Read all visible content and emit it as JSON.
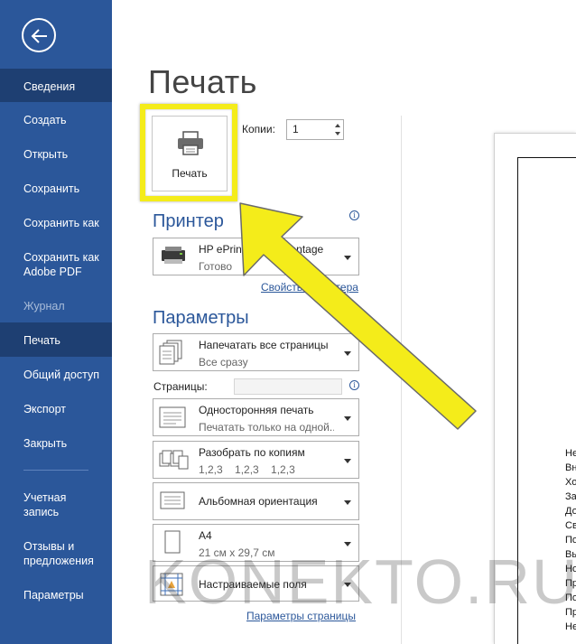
{
  "sidebar": {
    "items": [
      {
        "label": "Сведения",
        "state": "active"
      },
      {
        "label": "Создать",
        "state": "normal"
      },
      {
        "label": "Открыть",
        "state": "normal"
      },
      {
        "label": "Сохранить",
        "state": "normal"
      },
      {
        "label": "Сохранить как",
        "state": "normal"
      },
      {
        "label": "Сохранить как\nAdobe PDF",
        "state": "normal"
      },
      {
        "label": "Журнал",
        "state": "disabled"
      },
      {
        "label": "Печать",
        "state": "current"
      },
      {
        "label": "Общий доступ",
        "state": "normal"
      },
      {
        "label": "Экспорт",
        "state": "normal"
      },
      {
        "label": "Закрыть",
        "state": "normal"
      }
    ],
    "bottom_items": [
      {
        "label": "Учетная\nзапись"
      },
      {
        "label": "Отзывы и\nпредложения"
      },
      {
        "label": "Параметры"
      }
    ]
  },
  "page_title": "Печать",
  "print_button_label": "Печать",
  "copies": {
    "label": "Копии:",
    "value": "1"
  },
  "printer": {
    "section_title": "Принтер",
    "name": "HP ePrint + JetAdvantage",
    "status": "Готово",
    "properties_link": "Свойства принтера"
  },
  "settings": {
    "section_title": "Параметры",
    "print_range": {
      "title": "Напечатать все страницы",
      "subtitle": "Все сразу"
    },
    "pages_label": "Страницы:",
    "sides": {
      "title": "Односторонняя печать",
      "subtitle": "Печатать только на одной..."
    },
    "collate": {
      "title": "Разобрать по копиям",
      "subtitle": "1,2,3    1,2,3    1,2,3"
    },
    "orientation": {
      "title": "Альбомная ориентация"
    },
    "paper": {
      "title": "A4",
      "subtitle": "21 см x 29,7 см"
    },
    "margins": {
      "title": "Настраиваемые поля"
    },
    "page_setup_link": "Параметры страницы"
  },
  "preview_lines": [
    "Не",
    "Вн",
    "Хо",
    "За",
    "До",
    "Св",
    "По",
    "Вы",
    "Но",
    "Пр",
    "По",
    "Пр",
    "Не"
  ],
  "watermark": "KONEKTO.RU",
  "colors": {
    "sidebar": "#2b579a",
    "sidebar_active": "#1e3f72",
    "accent": "#2b579a",
    "highlight": "#f4ec1a"
  }
}
